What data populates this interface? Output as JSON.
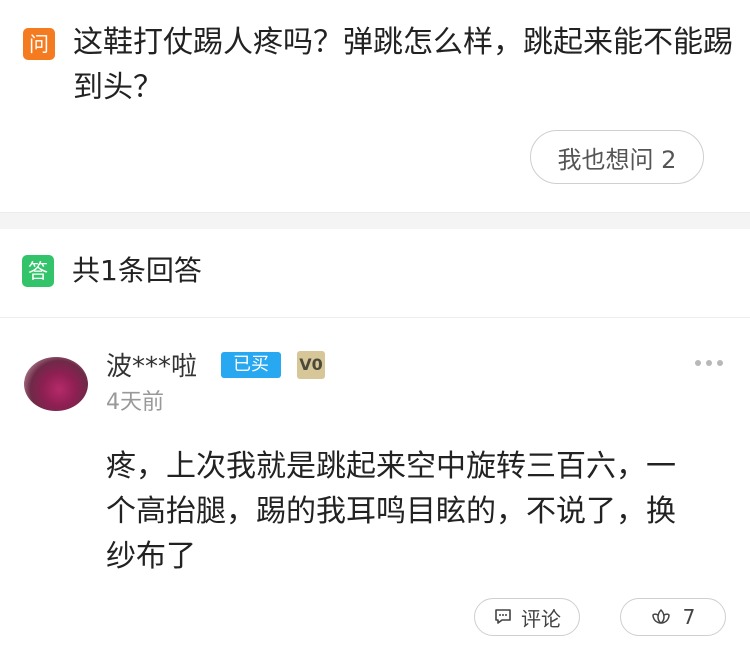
{
  "question": {
    "badge": "问",
    "text": "这鞋打仗踢人疼吗？弹跳怎么样，跳起来能不能踢到头？",
    "ask_button": "我也想问 2"
  },
  "answers_header": {
    "badge": "答",
    "count_text": "共1条回答"
  },
  "answer": {
    "username": "波***啦",
    "bought_badge": "已买",
    "vip_badge": "V0",
    "time": "4天前",
    "text": "疼，上次我就是跳起来空中旋转三百六，一个高抬腿，踢的我耳鸣目眩的，不说了，换纱布了",
    "comment_label": "评论",
    "like_count": "7"
  },
  "colors": {
    "question_badge": "#f47b20",
    "answer_badge": "#33c46b",
    "bought_badge": "#27a8f0",
    "vip_badge": "#d7c697"
  },
  "icons": {
    "more": "more-dots-icon",
    "comment": "comment-icon",
    "like": "lotus-like-icon"
  }
}
